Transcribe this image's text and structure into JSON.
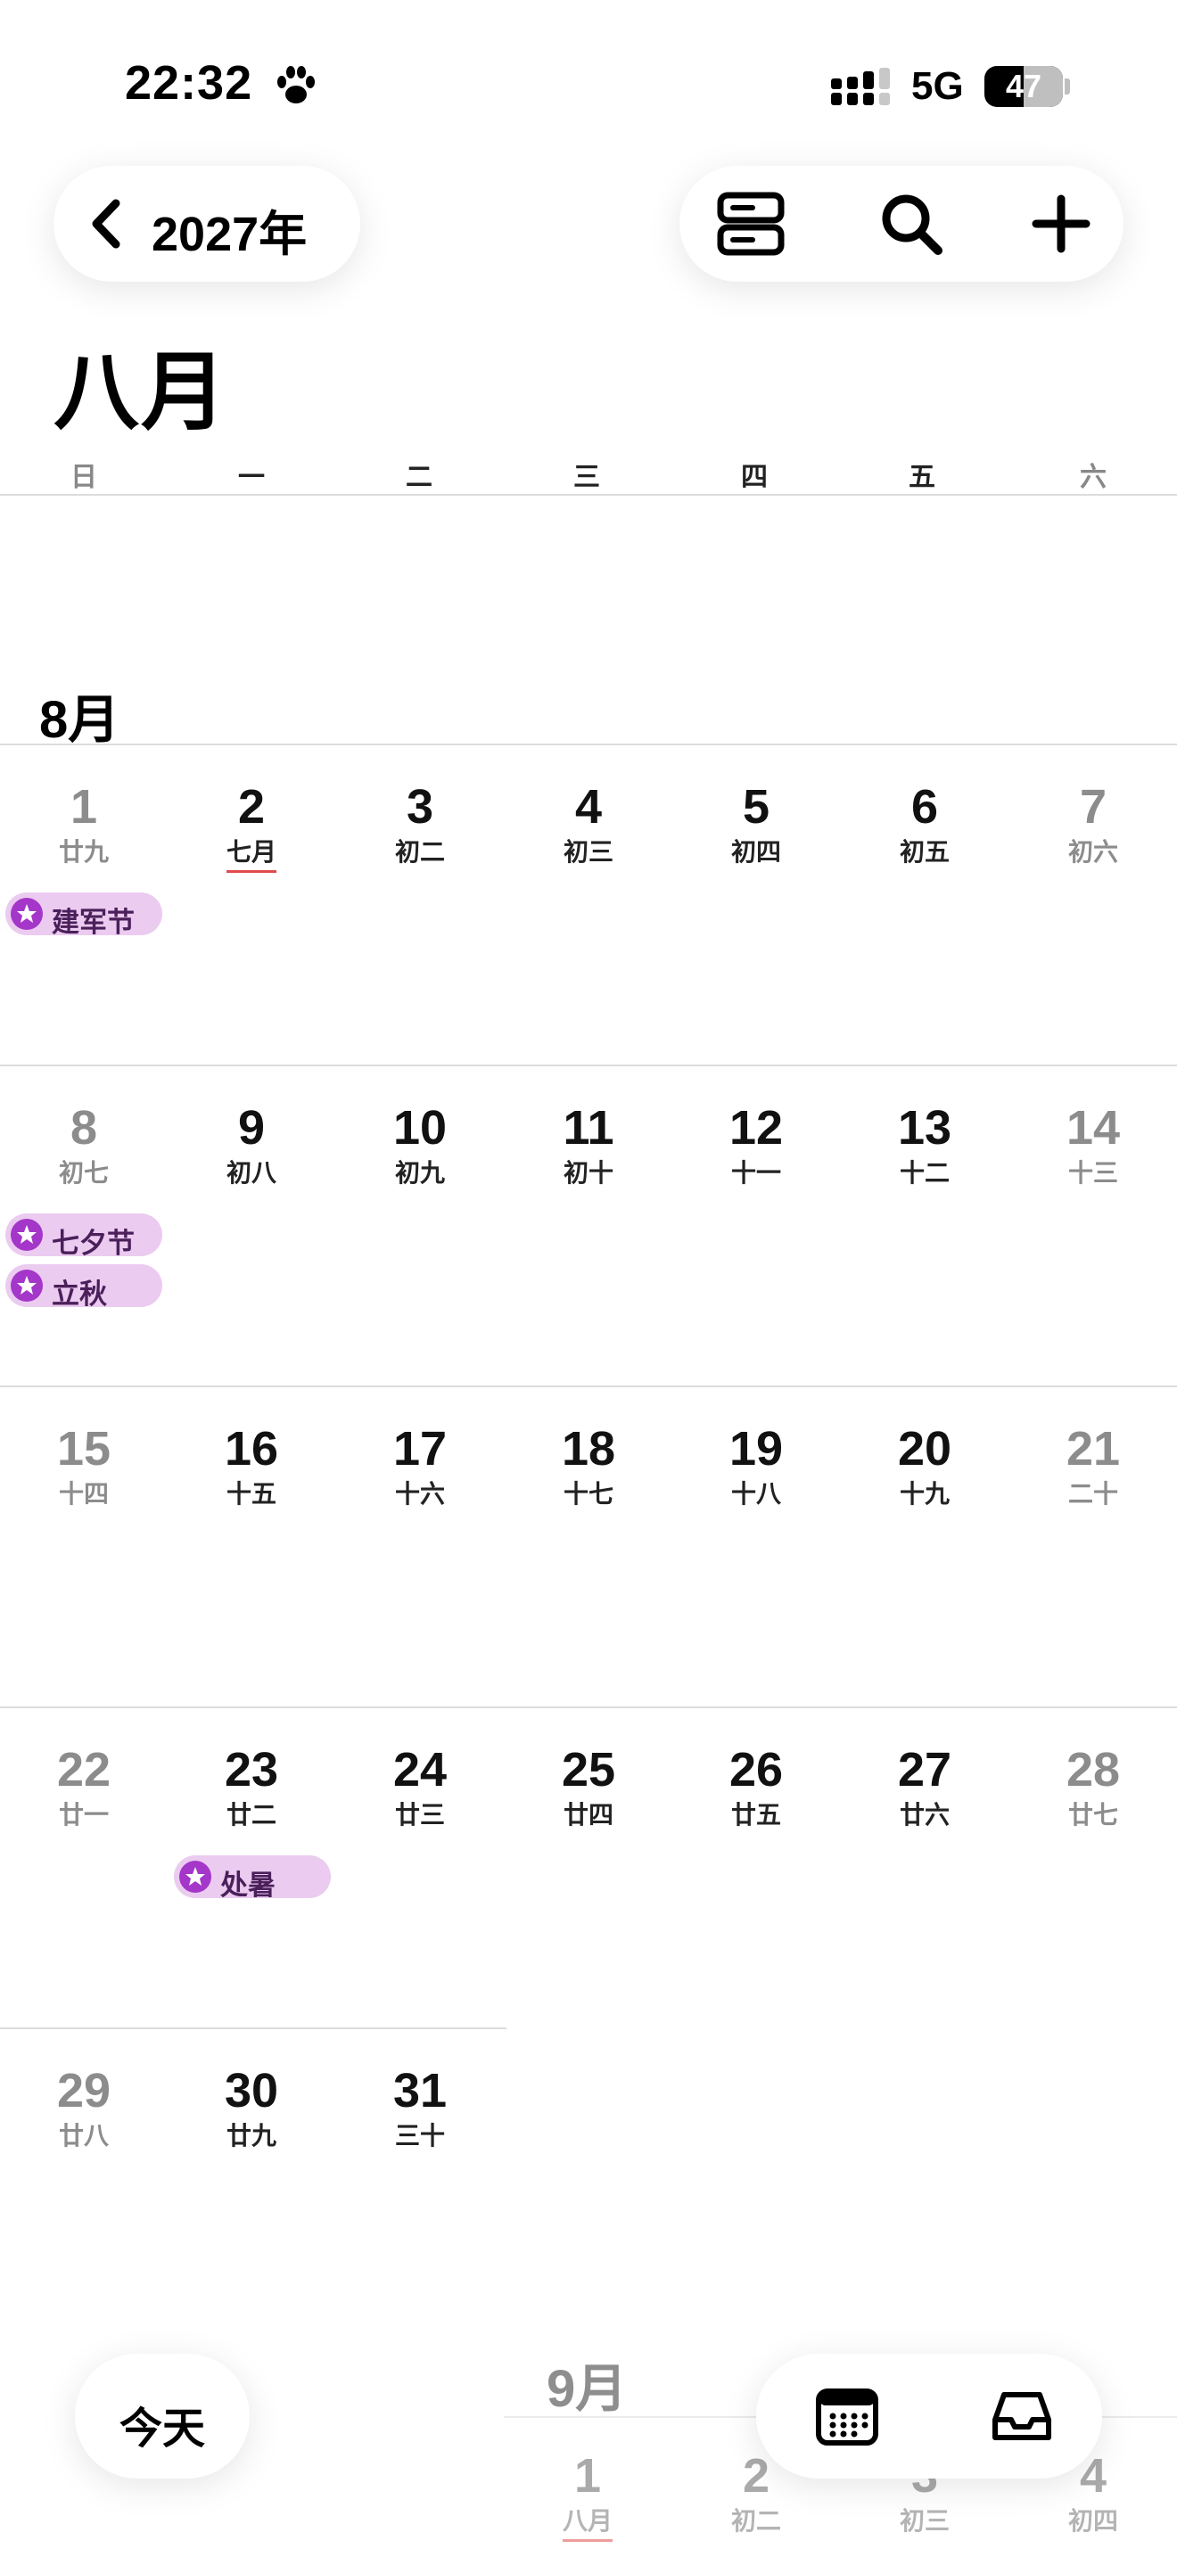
{
  "status": {
    "time": "22:32",
    "network": "5G",
    "battery": "47"
  },
  "header": {
    "year_label": "2027年",
    "month_title": "八月"
  },
  "icons": {
    "paw": "paw-icon",
    "signal": "signal-icon",
    "back": "chevron-left-icon",
    "view_toggle": "list-view-icon",
    "search": "search-icon",
    "add": "plus-icon",
    "calendar": "calendar-icon",
    "inbox": "inbox-icon",
    "event_marker": "star-icon"
  },
  "colors": {
    "event_chip": "#ebcbf0",
    "event_marker": "#a436c9",
    "underline": "#e34b4b",
    "weekend_text": "#8c8c8c"
  },
  "weekdays": [
    "日",
    "一",
    "二",
    "三",
    "四",
    "五",
    "六"
  ],
  "current_month_label": "8月",
  "weeks": [
    [
      {
        "num": "1",
        "lunar": "廿九"
      },
      {
        "num": "2",
        "lunar": "七月",
        "underline": true
      },
      {
        "num": "3",
        "lunar": "初二"
      },
      {
        "num": "4",
        "lunar": "初三"
      },
      {
        "num": "5",
        "lunar": "初四"
      },
      {
        "num": "6",
        "lunar": "初五"
      },
      {
        "num": "7",
        "lunar": "初六"
      }
    ],
    [
      {
        "num": "8",
        "lunar": "初七"
      },
      {
        "num": "9",
        "lunar": "初八"
      },
      {
        "num": "10",
        "lunar": "初九"
      },
      {
        "num": "11",
        "lunar": "初十"
      },
      {
        "num": "12",
        "lunar": "十一"
      },
      {
        "num": "13",
        "lunar": "十二"
      },
      {
        "num": "14",
        "lunar": "十三"
      }
    ],
    [
      {
        "num": "15",
        "lunar": "十四"
      },
      {
        "num": "16",
        "lunar": "十五"
      },
      {
        "num": "17",
        "lunar": "十六"
      },
      {
        "num": "18",
        "lunar": "十七"
      },
      {
        "num": "19",
        "lunar": "十八"
      },
      {
        "num": "20",
        "lunar": "十九"
      },
      {
        "num": "21",
        "lunar": "二十"
      }
    ],
    [
      {
        "num": "22",
        "lunar": "廿一"
      },
      {
        "num": "23",
        "lunar": "廿二"
      },
      {
        "num": "24",
        "lunar": "廿三"
      },
      {
        "num": "25",
        "lunar": "廿四"
      },
      {
        "num": "26",
        "lunar": "廿五"
      },
      {
        "num": "27",
        "lunar": "廿六"
      },
      {
        "num": "28",
        "lunar": "廿七"
      }
    ],
    [
      {
        "num": "29",
        "lunar": "廿八"
      },
      {
        "num": "30",
        "lunar": "廿九"
      },
      {
        "num": "31",
        "lunar": "三十"
      }
    ]
  ],
  "events": [
    {
      "label": "建军节"
    },
    {
      "label": "七夕节"
    },
    {
      "label": "立秋"
    },
    {
      "label": "处暑"
    }
  ],
  "next_month": {
    "label": "9月",
    "days": [
      {
        "num": "1",
        "lunar": "八月",
        "underline": true
      },
      {
        "num": "2",
        "lunar": "初二"
      },
      {
        "num": "3",
        "lunar": "初三"
      },
      {
        "num": "4",
        "lunar": "初四"
      }
    ]
  },
  "bottom": {
    "today_label": "今天"
  }
}
